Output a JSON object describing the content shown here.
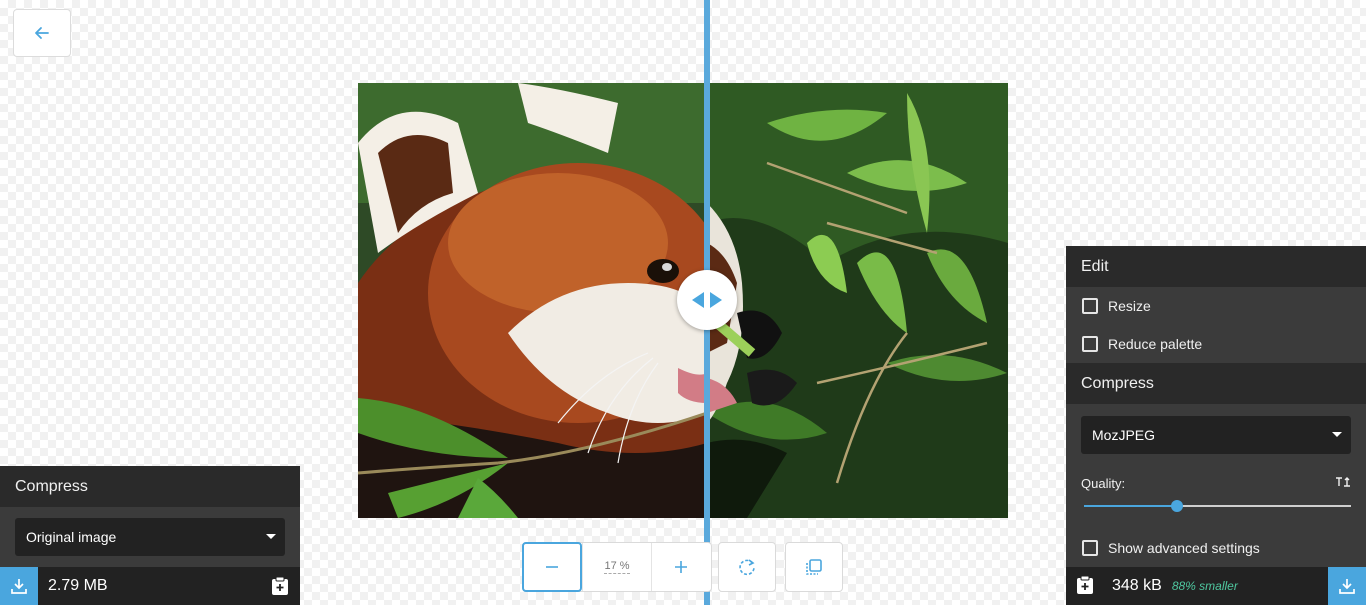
{
  "colors": {
    "accent": "#4aa6de",
    "panel_bg": "#3b3b3b",
    "panel_header_bg": "#2a2a2a",
    "savings_green": "#4fc8a0"
  },
  "back_button": {
    "icon": "arrow-left-icon"
  },
  "image": {
    "subject": "red-panda-photo"
  },
  "zoom": {
    "value": "17 %",
    "zoom_out_icon": "minus-icon",
    "zoom_in_icon": "plus-icon"
  },
  "toolbar": {
    "rotate_icon": "rotate-icon",
    "background_toggle_icon": "background-toggle-icon"
  },
  "left_panel": {
    "title": "Compress",
    "method": "Original image",
    "size": "2.79 MB"
  },
  "right_panel": {
    "edit_title": "Edit",
    "resize_label": "Resize",
    "resize_checked": false,
    "reduce_palette_label": "Reduce palette",
    "reduce_palette_checked": false,
    "compress_title": "Compress",
    "method": "MozJPEG",
    "quality_label": "Quality:",
    "quality_value": 0.35,
    "advanced_label": "Show advanced settings",
    "advanced_checked": false,
    "size": "348 kB",
    "savings": "88% smaller"
  }
}
